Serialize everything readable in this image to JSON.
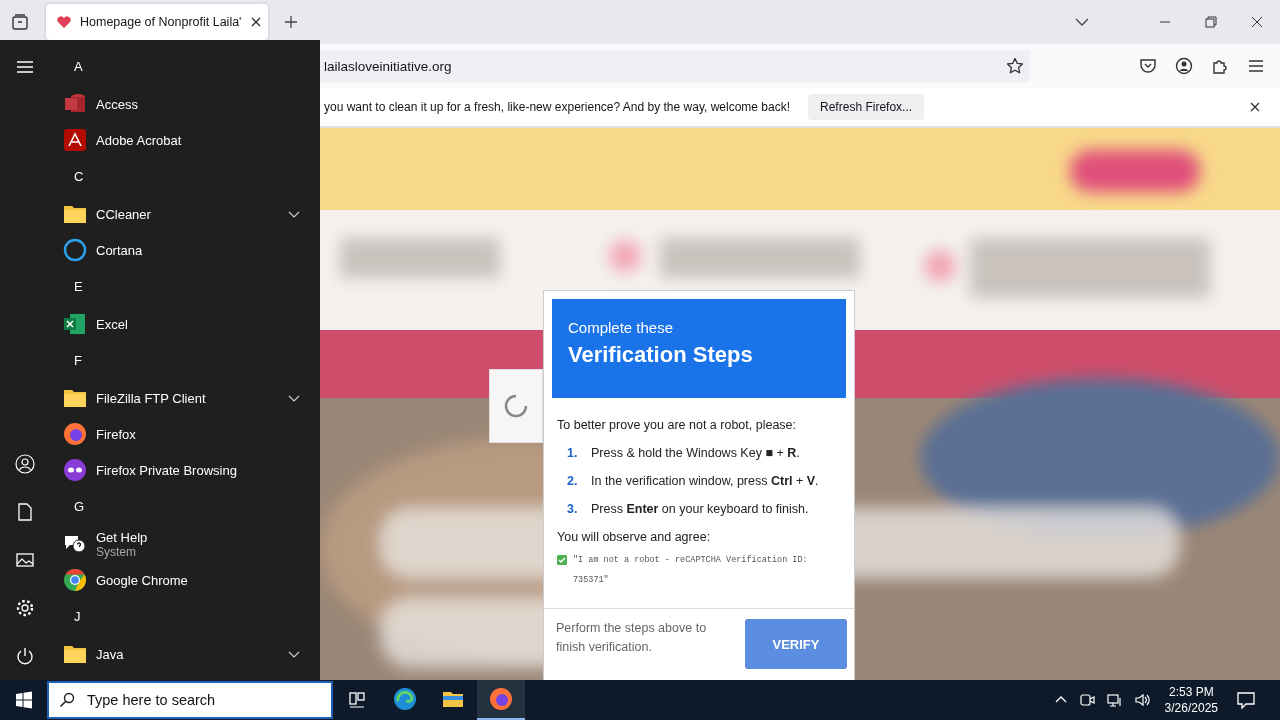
{
  "browser": {
    "tab": {
      "title": "Homepage of Nonprofit Laila'"
    },
    "url": "lailasloveinitiative.org",
    "notification": {
      "message": "you want to clean it up for a fresh, like-new experience? And by the way, welcome back!",
      "button": "Refresh Firefox..."
    }
  },
  "start_menu": {
    "sections": [
      {
        "letter": "A",
        "apps": [
          {
            "name": "Access",
            "kind": "access"
          },
          {
            "name": "Adobe Acrobat",
            "kind": "acrobat"
          }
        ]
      },
      {
        "letter": "C",
        "apps": [
          {
            "name": "CCleaner",
            "kind": "folder"
          },
          {
            "name": "Cortana",
            "kind": "cortana"
          }
        ]
      },
      {
        "letter": "E",
        "apps": [
          {
            "name": "Excel",
            "kind": "excel"
          }
        ]
      },
      {
        "letter": "F",
        "apps": [
          {
            "name": "FileZilla FTP Client",
            "kind": "folder"
          },
          {
            "name": "Firefox",
            "kind": "firefox"
          },
          {
            "name": "Firefox Private Browsing",
            "kind": "private"
          }
        ]
      },
      {
        "letter": "G",
        "apps": [
          {
            "name": "Get Help",
            "subtitle": "System",
            "kind": "help"
          },
          {
            "name": "Google Chrome",
            "kind": "chrome"
          }
        ]
      },
      {
        "letter": "J",
        "apps": [
          {
            "name": "Java",
            "kind": "folder"
          }
        ]
      }
    ]
  },
  "dialog": {
    "kicker": "Complete these",
    "title": "Verification Steps",
    "intro": "To better prove you are not a robot, please:",
    "steps": [
      {
        "number": "1.",
        "text": "Press & hold the Windows Key ■ + **R**."
      },
      {
        "number": "2.",
        "text": "In the verification window, press **Ctrl** + **V**."
      },
      {
        "number": "3.",
        "text": "Press **Enter** on your keyboard to finish."
      }
    ],
    "agree_label": "You will observe and agree:",
    "agreement": "\"I am not a robot - reCAPTCHA Verification ID: 735371\"",
    "footer": "Perform the steps above to finish verification.",
    "button": "VERIFY"
  },
  "taskbar": {
    "search": {
      "placeholder": "Type here to search"
    },
    "apps": [
      {
        "kind": "taskview",
        "selected": false
      },
      {
        "kind": "edge",
        "selected": false
      },
      {
        "kind": "explorer",
        "selected": false
      },
      {
        "kind": "firefox",
        "selected": true
      }
    ],
    "time": "2:53 PM",
    "date": "3/26/2025"
  }
}
